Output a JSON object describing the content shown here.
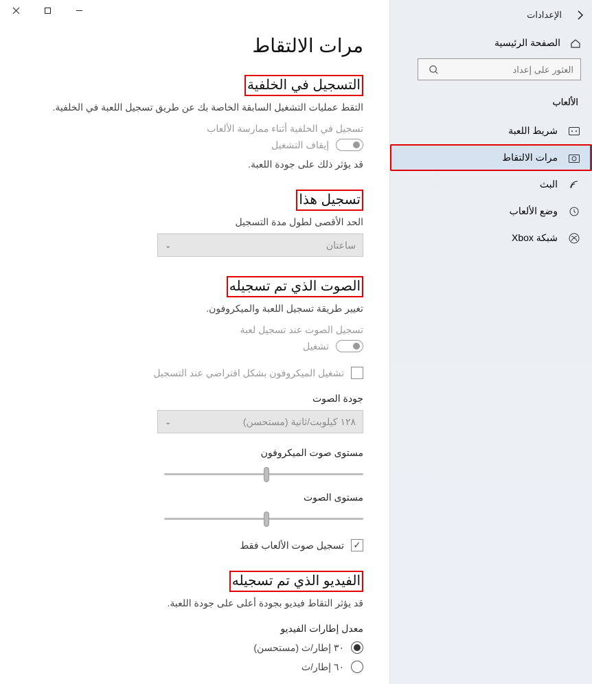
{
  "titlebar": {
    "app_title": "الإعدادات"
  },
  "sidebar": {
    "home": "الصفحة الرئيسية",
    "search_placeholder": "العثور على إعداد",
    "category": "الألعاب",
    "items": [
      {
        "label": "شريط اللعبة"
      },
      {
        "label": "مرات الالتقاط"
      },
      {
        "label": "البث"
      },
      {
        "label": "وضع الألعاب"
      },
      {
        "label": "شبكة Xbox"
      }
    ]
  },
  "page": {
    "title": "مرات الالتقاط",
    "bg": {
      "heading": "التسجيل في الخلفية",
      "desc": "التقط عمليات التشغيل السابقة الخاصة بك عن طريق تسجيل اللعبة في الخلفية.",
      "toggle_label": "تسجيل في الخلفية أثناء ممارسة الألعاب",
      "toggle_state": "إيقاف التشغيل",
      "note": "قد يؤثر ذلك على جودة اللعبة."
    },
    "record_this": {
      "heading": "تسجيل هذا",
      "desc": "الحد الأقصى لطول مدة التسجيل",
      "select_value": "ساعتان"
    },
    "audio": {
      "heading": "الصوت الذي تم تسجيله",
      "desc": "تغيير طريقة تسجيل اللعبة والميكروفون.",
      "toggle_label": "تسجيل الصوت عند تسجيل لعبة",
      "toggle_state": "تشغيل",
      "mic_default": "تشغيل الميكروفون بشكل افتراضي عند التسجيل",
      "quality_label": "جودة الصوت",
      "quality_value": "١٢٨ كيلوبت/ثانية (مستحسن)",
      "mic_volume": "مستوى صوت الميكروفون",
      "sys_volume": "مستوى الصوت",
      "game_only": "تسجيل صوت الألعاب فقط"
    },
    "video": {
      "heading": "الفيديو الذي تم تسجيله",
      "desc": "قد يؤثر التقاط فيديو بجودة أعلى على جودة اللعبة.",
      "fps_label": "معدل إطارات الفيديو",
      "fps30": "٣٠ إطار/ث (مستحسن)",
      "fps60": "٦٠ إطار/ث"
    }
  }
}
